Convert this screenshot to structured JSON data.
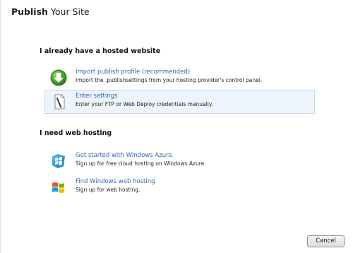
{
  "window": {
    "title_bold": "Publish",
    "title_rest": " Your Site"
  },
  "sections": {
    "hosted_heading": "I already have a hosted website",
    "webhosting_heading": "I need web hosting"
  },
  "options": {
    "import": {
      "link": "Import publish profile (recommended)",
      "description": "Import the .publishsettings from your hosting provider's control panel.",
      "icon": "download-arrow-icon"
    },
    "settings": {
      "link": "Enter settings",
      "description": "Enter your FTP or Web Deploy credentials manually.",
      "icon": "pen-document-icon",
      "selected": true
    },
    "azure": {
      "link": "Get started with Windows Azure.",
      "description": "Sign up for free cloud hosting on Windows Azure",
      "icon": "windows-azure-icon"
    },
    "windows_hosting": {
      "link": "Find Windows web hosting",
      "description": "Sign up for web hosting.",
      "icon": "windows-flag-icon"
    }
  },
  "footer": {
    "cancel_label": "Cancel"
  },
  "colors": {
    "link": "#2a6cb3",
    "selected_bg": "#eef4fb",
    "selected_border": "#c6d7ea"
  }
}
